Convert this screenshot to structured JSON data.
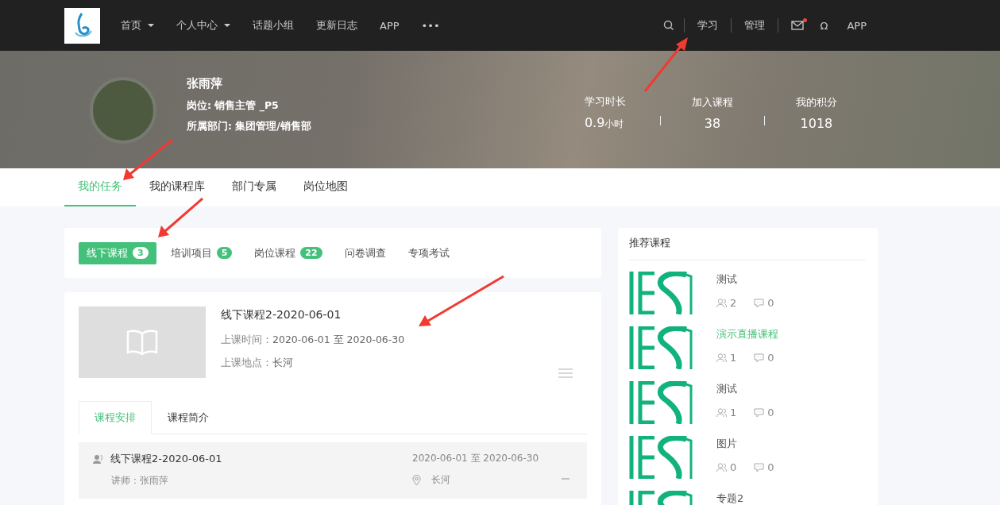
{
  "nav": {
    "items": [
      {
        "label": "首页",
        "kind": "dropdown"
      },
      {
        "label": "个人中心",
        "kind": "dropdown"
      },
      {
        "label": "话题小组",
        "kind": "link"
      },
      {
        "label": "更新日志",
        "kind": "link"
      },
      {
        "label": "APP",
        "kind": "link"
      },
      {
        "label": "•••",
        "kind": "link"
      }
    ],
    "right": [
      {
        "label": "学习",
        "divider_before": true
      },
      {
        "label": "管理",
        "divider_before": true
      }
    ],
    "mail_unread": true,
    "user_glyph": "Ω",
    "app_label": "APP"
  },
  "profile": {
    "name": "张雨萍",
    "position": "岗位: 销售主管 _P5",
    "department": "所属部门: 集团管理/销售部",
    "stats": [
      {
        "label": "学习时长",
        "value": "0.9",
        "unit": "小时"
      },
      {
        "label": "加入课程",
        "value": "38"
      },
      {
        "label": "我的积分",
        "value": "1018"
      }
    ]
  },
  "main_tabs": [
    {
      "label": "我的任务",
      "selected": true
    },
    {
      "label": "我的课程库",
      "selected": false
    },
    {
      "label": "部门专属",
      "selected": false
    },
    {
      "label": "岗位地图",
      "selected": false
    }
  ],
  "filters": [
    {
      "label": "线下课程",
      "count": "3",
      "selected": true
    },
    {
      "label": "培训项目",
      "count": "5",
      "selected": false
    },
    {
      "label": "岗位课程",
      "count": "22",
      "selected": false
    },
    {
      "label": "问卷调查",
      "selected": false
    },
    {
      "label": "专项考试",
      "selected": false
    }
  ],
  "course": {
    "title": "线下课程2-2020-06-01",
    "time_label": "上课时间：",
    "time": "2020-06-01 至 2020-06-30",
    "place_label": "上课地点：",
    "place": "长河",
    "tabs": [
      {
        "label": "课程安排",
        "selected": true
      },
      {
        "label": "课程简介",
        "selected": false
      }
    ],
    "schedule": [
      {
        "title": "线下课程2-2020-06-01",
        "teacher": "讲师：张雨萍",
        "time": "2020-06-01 至 2020-06-30",
        "place": "长河"
      }
    ]
  },
  "recommend": {
    "title": "推荐课程",
    "items": [
      {
        "title": "测试",
        "highlighted": false,
        "students": "2",
        "comments": "0"
      },
      {
        "title": "演示直播课程",
        "highlighted": true,
        "students": "1",
        "comments": "0"
      },
      {
        "title": "测试",
        "highlighted": false,
        "students": "1",
        "comments": "0"
      },
      {
        "title": "图片",
        "highlighted": false,
        "students": "0",
        "comments": "0"
      },
      {
        "title": "专题2",
        "highlighted": false
      }
    ]
  }
}
